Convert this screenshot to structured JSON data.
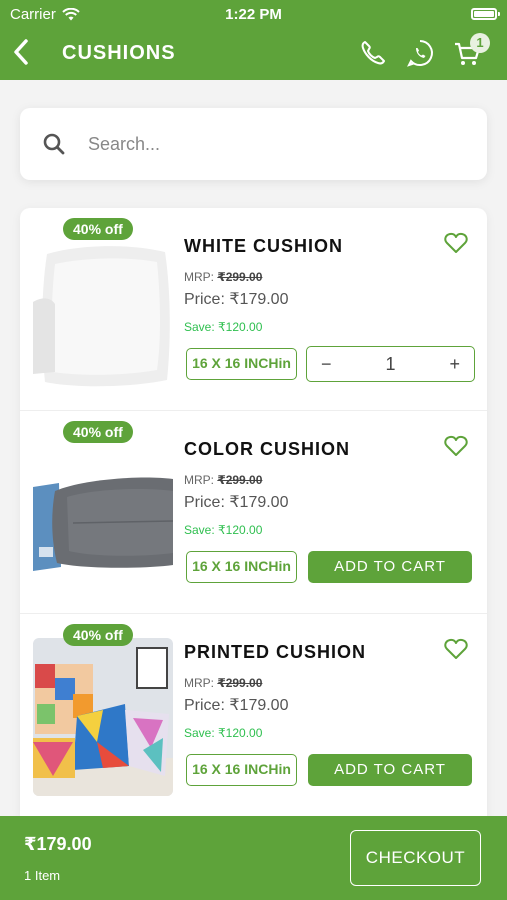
{
  "status_bar": {
    "carrier": "Carrier",
    "time": "1:22 PM"
  },
  "header": {
    "title": "CUSHIONS",
    "cart_count": "1"
  },
  "search": {
    "placeholder": "Search..."
  },
  "products": [
    {
      "discount": "40% off",
      "name": "WHITE CUSHION",
      "mrp_label": "MRP:",
      "mrp": "₹299.00",
      "price_label": "Price:",
      "price": "₹179.00",
      "save_label": "Save:",
      "save": "₹120.00",
      "size": "16 X 16 INCHin",
      "quantity": "1",
      "in_cart": true
    },
    {
      "discount": "40% off",
      "name": "COLOR CUSHION",
      "mrp_label": "MRP:",
      "mrp": "₹299.00",
      "price_label": "Price:",
      "price": "₹179.00",
      "save_label": "Save:",
      "save": "₹120.00",
      "size": "16 X 16 INCHin",
      "add_label": "ADD TO CART",
      "in_cart": false
    },
    {
      "discount": "40% off",
      "name": "PRINTED CUSHION",
      "mrp_label": "MRP:",
      "mrp": "₹299.00",
      "price_label": "Price:",
      "price": "₹179.00",
      "save_label": "Save:",
      "save": "₹120.00",
      "size": "16 X 16 INCHin",
      "add_label": "ADD TO CART",
      "in_cart": false
    }
  ],
  "stepper": {
    "minus": "−",
    "plus": "+"
  },
  "footer": {
    "total": "₹179.00",
    "items": "1 Item",
    "checkout_label": "CHECKOUT"
  },
  "colors": {
    "primary": "#5ea33a",
    "save_text": "#2fbf4f"
  }
}
